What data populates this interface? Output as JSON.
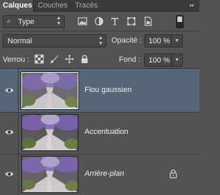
{
  "tabs": [
    {
      "label": "Calques",
      "active": true
    },
    {
      "label": "Couches",
      "active": false
    },
    {
      "label": "Tracés",
      "active": false
    }
  ],
  "filter": {
    "label": "Type",
    "icon": "search-icon",
    "icons": [
      "image-filter-icon",
      "adjustment-filter-icon",
      "type-filter-icon",
      "shape-filter-icon",
      "smart-object-filter-icon"
    ]
  },
  "blend": {
    "mode": "Normal"
  },
  "opacity": {
    "label": "Opacité :",
    "value": "100 %"
  },
  "lock": {
    "label": "Verrou :",
    "icons": [
      "lock-pixels-icon",
      "lock-brush-icon",
      "lock-position-icon",
      "lock-all-icon"
    ]
  },
  "fill": {
    "label": "Fond :",
    "value": "100 %"
  },
  "layers": [
    {
      "name": "Flou gaussien",
      "selected": true,
      "italic": false,
      "locked": false
    },
    {
      "name": "Accentuation",
      "selected": false,
      "italic": false,
      "locked": false
    },
    {
      "name": "Arrière-plan",
      "selected": false,
      "italic": true,
      "locked": true
    }
  ],
  "colors": {
    "panel": "#535353",
    "selected_row": "#576677",
    "tab_bar": "#3a3a3a"
  }
}
